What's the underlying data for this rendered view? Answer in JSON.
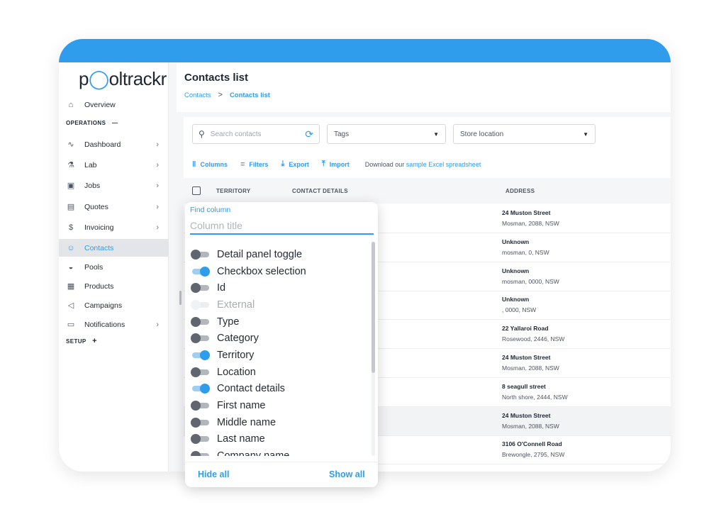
{
  "app": {
    "logo_text_a": "p",
    "logo_text_b": "oltrackr"
  },
  "sidebar": {
    "items_top": [
      {
        "label": "Overview",
        "icon": "home-icon"
      }
    ],
    "operations_label": "OPERATIONS",
    "operations_toggle": "—",
    "items": [
      {
        "label": "Dashboard",
        "icon": "chart-line-icon",
        "chevron": true
      },
      {
        "label": "Lab",
        "icon": "flask-icon",
        "chevron": true
      },
      {
        "label": "Jobs",
        "icon": "calendar-check-icon",
        "chevron": true
      },
      {
        "label": "Quotes",
        "icon": "clipboard-icon",
        "chevron": true
      },
      {
        "label": "Invoicing",
        "icon": "dollar-circle-icon",
        "chevron": true
      },
      {
        "label": "Contacts",
        "icon": "user-icon",
        "chevron": false,
        "active": true
      },
      {
        "label": "Pools",
        "icon": "droplet-icon",
        "chevron": false
      },
      {
        "label": "Products",
        "icon": "box-icon",
        "chevron": false
      },
      {
        "label": "Campaigns",
        "icon": "megaphone-icon",
        "chevron": false
      },
      {
        "label": "Notifications",
        "icon": "chat-icon",
        "chevron": true
      }
    ],
    "setup_label": "SETUP",
    "setup_toggle": "+"
  },
  "header": {
    "title": "Contacts list",
    "breadcrumb": [
      "Contacts",
      "Contacts list"
    ],
    "breadcrumb_sep": ">"
  },
  "filters": {
    "search_placeholder": "Search contacts",
    "tags_label": "Tags",
    "store_location_label": "Store location"
  },
  "toolbar": {
    "columns": "Columns",
    "filters": "Filters",
    "export": "Export",
    "import": "Import",
    "note_prefix": "Download our",
    "note_link": "sample Excel spreadsheet"
  },
  "table": {
    "headers": {
      "territory": "TERRITORY",
      "contact_details": "CONTACT DETAILS",
      "address": "ADDRESS"
    },
    "rows": [
      {
        "address_line1": "24 Muston Street",
        "address_line2": "Mosman, 2088, NSW"
      },
      {
        "address_line1": "Unknown",
        "address_line2": "mosman, 0, NSW"
      },
      {
        "address_line1": "Unknown",
        "address_line2": "mosman, 0000, NSW"
      },
      {
        "address_line1": "Unknown",
        "address_line2": ", 0000, NSW"
      },
      {
        "address_line1": "22 Yallaroi Road",
        "address_line2": "Rosewood, 2446, NSW"
      },
      {
        "address_line1": "24 Muston Street",
        "address_line2": "Mosman, 2088, NSW"
      },
      {
        "address_line1": "8 seagull street",
        "address_line2": "North shore, 2444, NSW"
      },
      {
        "address_line1": "24 Muston Street",
        "address_line2": "Mosman, 2088, NSW",
        "highlighted": true
      },
      {
        "address_line1": "3106 O'Connell Road",
        "address_line2": "Brewongle, 2795, NSW"
      }
    ]
  },
  "column_panel": {
    "find_label": "Find column",
    "input_placeholder": "Column title",
    "options": [
      {
        "label": "Detail panel toggle",
        "state": "off"
      },
      {
        "label": "Checkbox selection",
        "state": "on"
      },
      {
        "label": "Id",
        "state": "off"
      },
      {
        "label": "External",
        "state": "disabled"
      },
      {
        "label": "Type",
        "state": "off"
      },
      {
        "label": "Category",
        "state": "off"
      },
      {
        "label": "Territory",
        "state": "on"
      },
      {
        "label": "Location",
        "state": "off"
      },
      {
        "label": "Contact details",
        "state": "on"
      },
      {
        "label": "First name",
        "state": "off"
      },
      {
        "label": "Middle name",
        "state": "off"
      },
      {
        "label": "Last name",
        "state": "off"
      },
      {
        "label": "Company name",
        "state": "off"
      }
    ],
    "hide_all": "Hide all",
    "show_all": "Show all"
  },
  "colors": {
    "accent": "#2f9cec",
    "active_bg": "#e3e5e8"
  }
}
